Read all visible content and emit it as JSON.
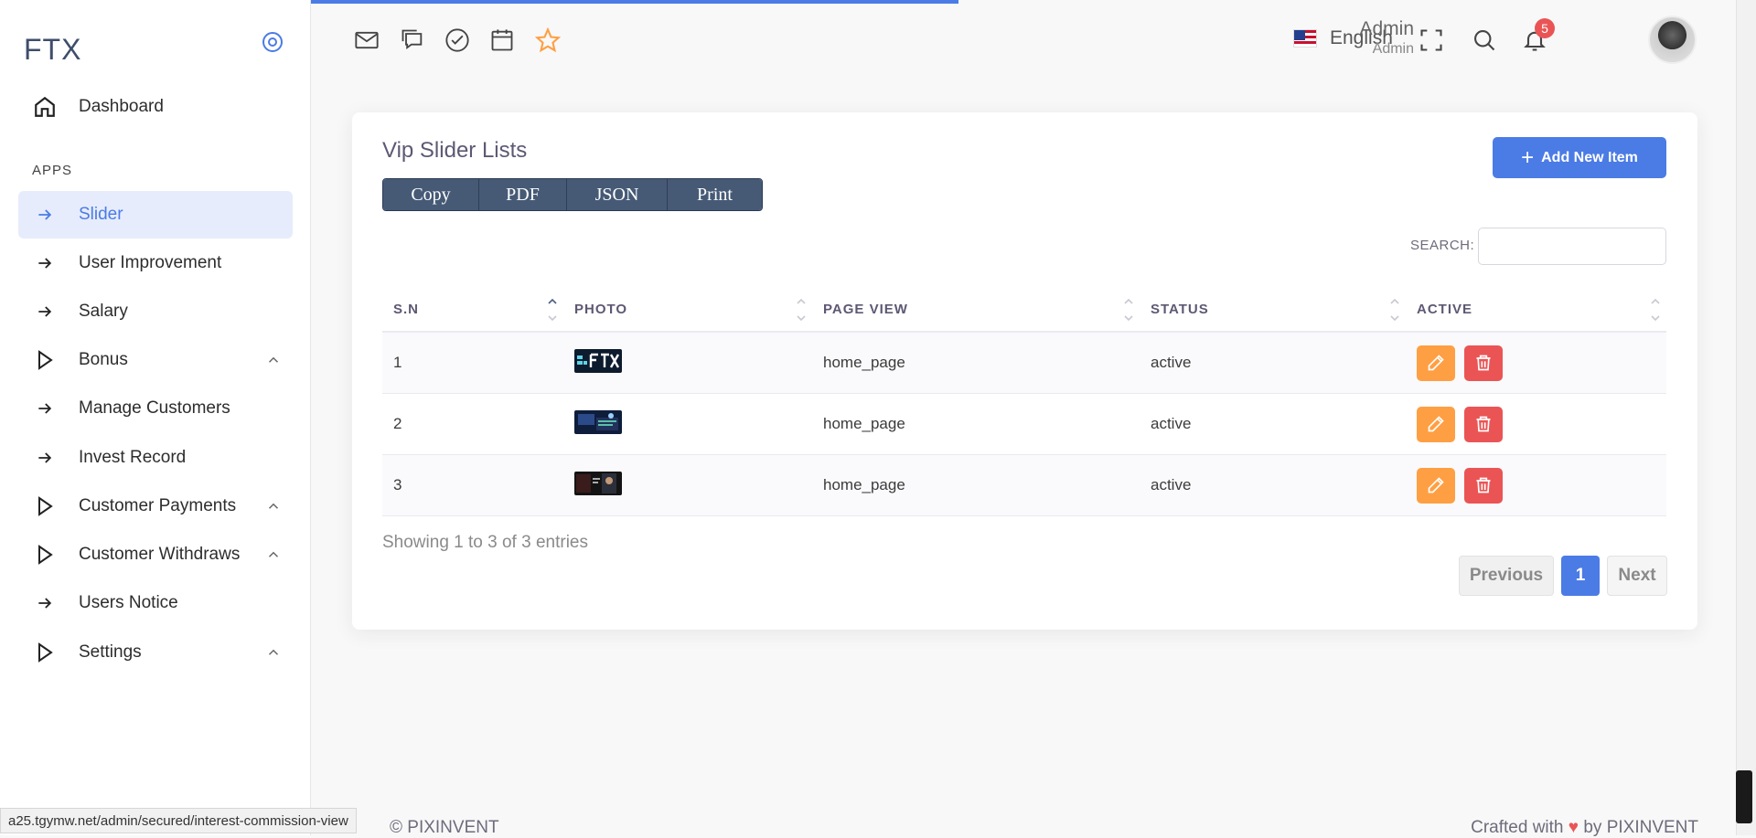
{
  "brand": "FTX",
  "sidebar": {
    "dashboard": "Dashboard",
    "section": "APPS",
    "items": [
      {
        "label": "Slider",
        "icon": "arrow-right-icon"
      },
      {
        "label": "User Improvement",
        "icon": "arrow-right-icon"
      },
      {
        "label": "Salary",
        "icon": "arrow-right-icon"
      },
      {
        "label": "Bonus",
        "icon": "play-icon"
      },
      {
        "label": "Manage Customers",
        "icon": "arrow-right-icon"
      },
      {
        "label": "Invest Record",
        "icon": "arrow-right-icon"
      },
      {
        "label": "Customer Payments",
        "icon": "play-icon"
      },
      {
        "label": "Customer Withdraws",
        "icon": "play-icon"
      },
      {
        "label": "Users Notice",
        "icon": "arrow-right-icon"
      },
      {
        "label": "Settings",
        "icon": "play-icon"
      }
    ]
  },
  "header": {
    "language": "English",
    "notification_count": "5",
    "user_name": "Admin",
    "user_role": "Admin"
  },
  "card": {
    "title": "Vip Slider Lists",
    "export_buttons": [
      "Copy",
      "PDF",
      "JSON",
      "Print"
    ],
    "add_button": "Add New Item",
    "search_label": "SEARCH:",
    "search_value": "",
    "columns": [
      "S.N",
      "PHOTO",
      "PAGE VIEW",
      "STATUS",
      "ACTIVE"
    ],
    "rows": [
      {
        "sn": "1",
        "page_view": "home_page",
        "status": "active"
      },
      {
        "sn": "2",
        "page_view": "home_page",
        "status": "active"
      },
      {
        "sn": "3",
        "page_view": "home_page",
        "status": "active"
      }
    ],
    "info": "Showing 1 to 3 of 3 entries",
    "pagination": {
      "previous": "Previous",
      "page": "1",
      "next": "Next"
    }
  },
  "footer": {
    "left": "© PIXINVENT",
    "right_prefix": "Crafted with",
    "right_suffix": "by PIXINVENT"
  },
  "status_url": "a25.tgymw.net/admin/secured/interest-commission-view",
  "colors": {
    "accent": "#4b7be5",
    "edit": "#ff9f43",
    "delete": "#ea5455"
  }
}
